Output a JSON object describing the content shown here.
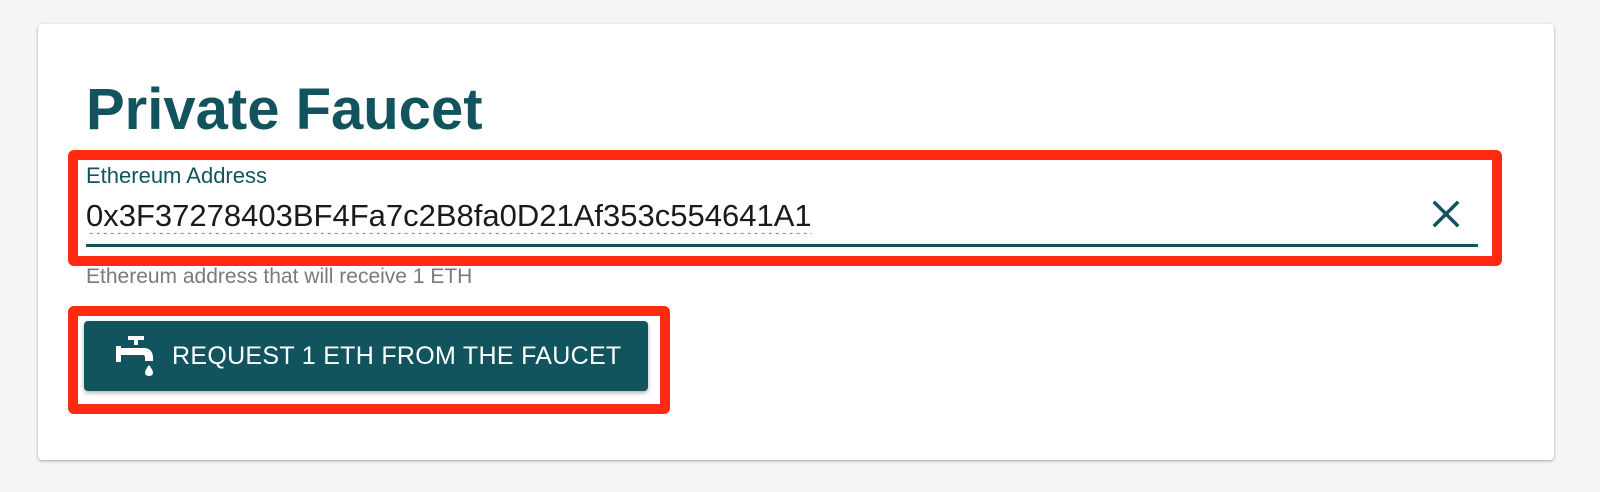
{
  "card": {
    "title": "Private Faucet"
  },
  "address_field": {
    "label": "Ethereum Address",
    "value": "0x3F37278403BF4Fa7c2B8fa0D21Af353c554641A1",
    "helper_text": "Ethereum address that will receive 1 ETH",
    "clear_icon": "close-icon"
  },
  "request_button": {
    "label": "REQUEST 1 ETH FROM THE FAUCET",
    "icon": "faucet-icon"
  },
  "colors": {
    "accent": "#12545e",
    "highlight": "#ff2a10",
    "helper_text": "#7a7a7a",
    "background": "#f5f5f5",
    "card": "#ffffff"
  }
}
